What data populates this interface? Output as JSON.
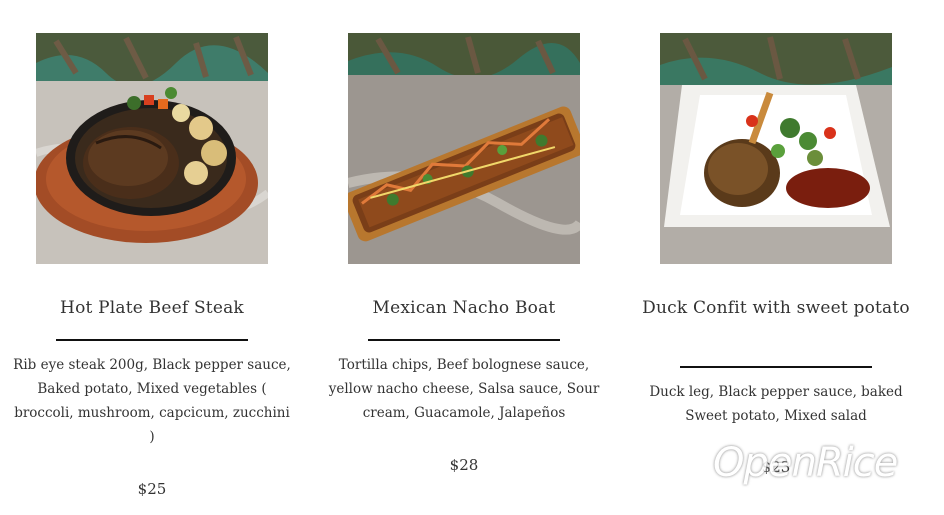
{
  "menu": {
    "items": [
      {
        "name": "Hot Plate Beef Steak",
        "description": "Rib eye steak 200g, Black pepper sauce, Baked potato, Mixed vegetables ( broccoli, mushroom, capcicum, zucchini )",
        "price": "$25",
        "image_icon": "steak-photo-icon"
      },
      {
        "name": "Mexican Nacho Boat",
        "description": "Tortilla chips, Beef bolognese sauce, yellow nacho cheese, Salsa sauce, Sour cream, Guacamole, Jalapeños",
        "price": "$28",
        "image_icon": "nacho-photo-icon"
      },
      {
        "name": "Duck Confit with sweet potato",
        "description": "Duck leg, Black pepper sauce, baked Sweet potato, Mixed salad",
        "price": "$23",
        "image_icon": "duck-photo-icon"
      }
    ]
  },
  "watermark": "OpenRice"
}
